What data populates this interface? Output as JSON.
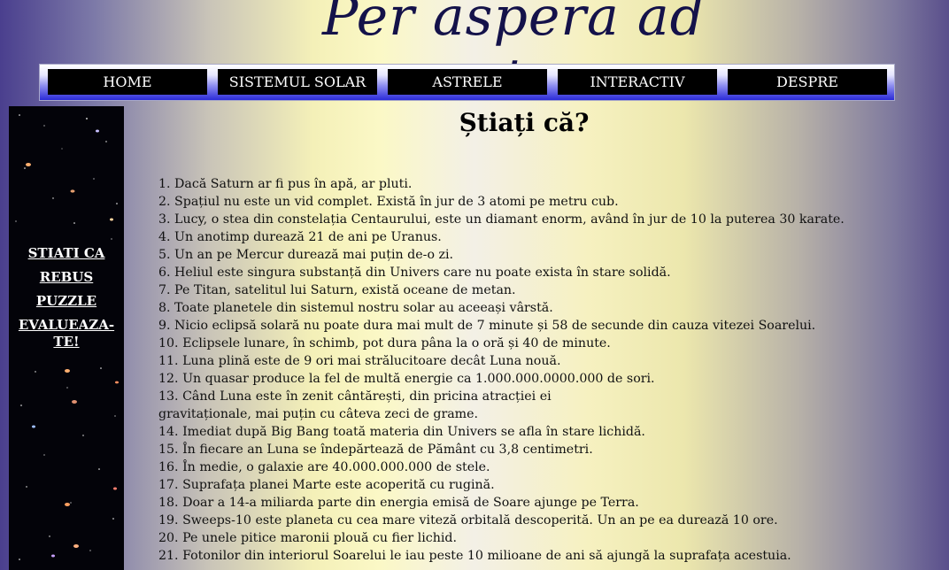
{
  "header": {
    "logo_text": "Per aspera ad astra"
  },
  "nav": {
    "items": [
      "HOME",
      "SISTEMUL SOLAR",
      "ASTRELE",
      "INTERACTIV",
      "DESPRE"
    ]
  },
  "sidebar": {
    "links": [
      "STIATI CA",
      "REBUS",
      "PUZZLE",
      "EVALUEAZA-TE!"
    ]
  },
  "main": {
    "title": "Știați că?",
    "facts": [
      "1. Dacă Saturn ar fi pus în apă, ar pluti.",
      "2. Spațiul nu este un vid complet. Există în jur de 3 atomi pe metru cub.",
      "3. Lucy, o stea din constelația Centaurului, este un diamant enorm, având în jur de 10 la puterea 30 karate.",
      "4. Un anotimp durează 21 de ani pe Uranus.",
      "5. Un an pe Mercur durează mai puțin de-o zi.",
      "6. Heliul este singura substanță din Univers care nu poate exista în stare solidă.",
      "7. Pe Titan, satelitul lui Saturn, există oceane de metan.",
      "8. Toate planetele din sistemul nostru solar au aceeași vârstă.",
      "9. Nicio eclipsă solară nu poate dura mai mult de 7 minute și 58 de secunde din cauza vitezei Soarelui.",
      "10. Eclipsele lunare, în schimb, pot dura pâna la o oră și 40 de minute.",
      "11. Luna plină este de 9 ori mai strălucitoare decât Luna nouă.",
      "12. Un quasar produce la fel de multă energie ca 1.000.000.0000.000 de sori.",
      "13. Când Luna este în zenit cântărești, din pricina atracției ei",
      "gravitaționale, mai puțin cu câteva zeci de grame.",
      "14. Imediat după Big Bang toată materia din Univers se afla în stare lichidă.",
      "15. În fiecare an Luna se îndepărtează de Pământ cu 3,8 centimetri.",
      "16. În medie, o galaxie are 40.000.000.000 de stele.",
      "17. Suprafața planei Marte este acoperită cu rugină.",
      "18. Doar a 14-a miliarda parte din energia emisă de Soare ajunge pe Terra.",
      "19. Sweeps-10 este planeta cu cea mare viteză orbitală descoperită. Un an pe ea durează 10 ore.",
      "20. Pe unele pitice maronii plouă cu fier lichid.",
      "21. Fotonilor din interiorul Soarelui le iau peste 10 milioane de ani să ajungă la suprafața acestuia."
    ]
  }
}
